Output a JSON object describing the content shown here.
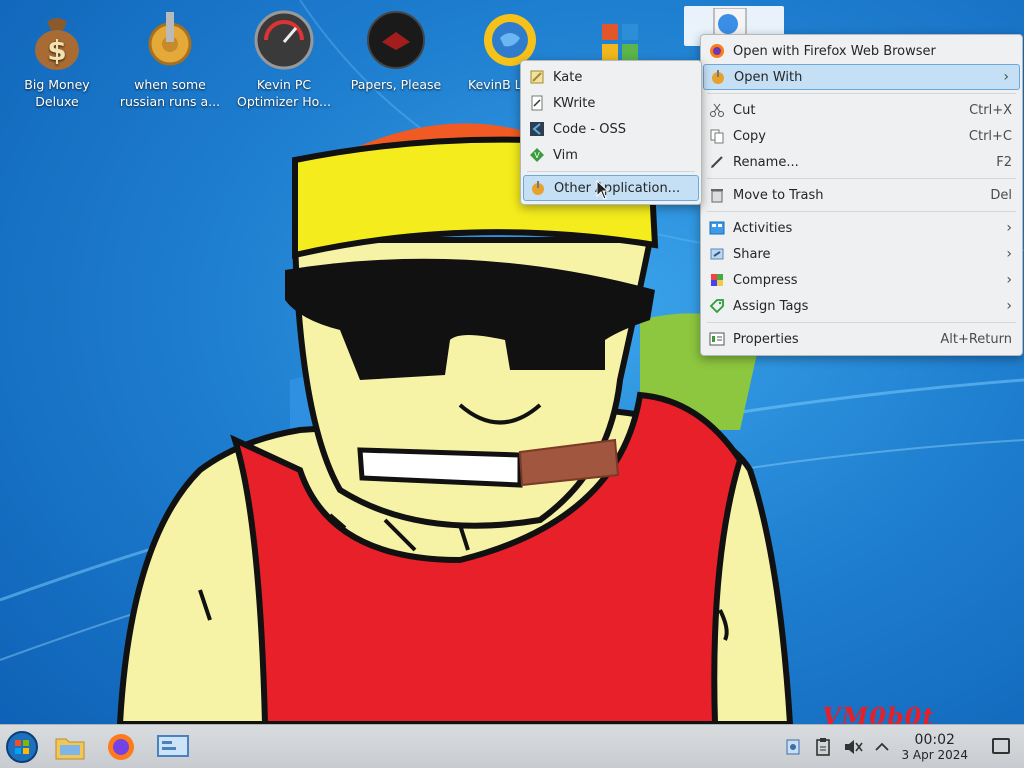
{
  "desktop": {
    "icons": [
      {
        "label": "Big Money Deluxe"
      },
      {
        "label": "when some russian runs a..."
      },
      {
        "label": "Kevin PC Optimizer Ho..."
      },
      {
        "label": "Papers, Please"
      },
      {
        "label": "KevinB Launc"
      }
    ],
    "watermark": "VM0b0t"
  },
  "context_menu": {
    "items": [
      {
        "label": "Open with Firefox Web Browser",
        "icon": "firefox-icon"
      },
      {
        "label": "Open With",
        "icon": "open-with-icon",
        "submenu": true,
        "highlighted": true
      },
      {
        "label": "Cut",
        "shortcut": "Ctrl+X",
        "icon": "cut-icon"
      },
      {
        "label": "Copy",
        "shortcut": "Ctrl+C",
        "icon": "copy-icon"
      },
      {
        "label": "Rename...",
        "shortcut": "F2",
        "icon": "rename-icon"
      },
      {
        "label": "Move to Trash",
        "shortcut": "Del",
        "icon": "trash-icon"
      },
      {
        "label": "Activities",
        "icon": "activities-icon",
        "submenu": true
      },
      {
        "label": "Share",
        "icon": "share-icon",
        "submenu": true
      },
      {
        "label": "Compress",
        "icon": "compress-icon",
        "submenu": true
      },
      {
        "label": "Assign Tags",
        "icon": "tag-icon",
        "submenu": true
      },
      {
        "label": "Properties",
        "shortcut": "Alt+Return",
        "icon": "properties-icon"
      }
    ]
  },
  "open_with_submenu": {
    "items": [
      {
        "label": "Kate",
        "icon": "kate-icon"
      },
      {
        "label": "KWrite",
        "icon": "kwrite-icon"
      },
      {
        "label": "Code - OSS",
        "icon": "code-oss-icon"
      },
      {
        "label": "Vim",
        "icon": "vim-icon"
      },
      {
        "label": "Other Application...",
        "icon": "other-application-icon",
        "highlighted": true
      }
    ]
  },
  "taskbar": {
    "time": "00:02",
    "date": "3 Apr 2024"
  }
}
